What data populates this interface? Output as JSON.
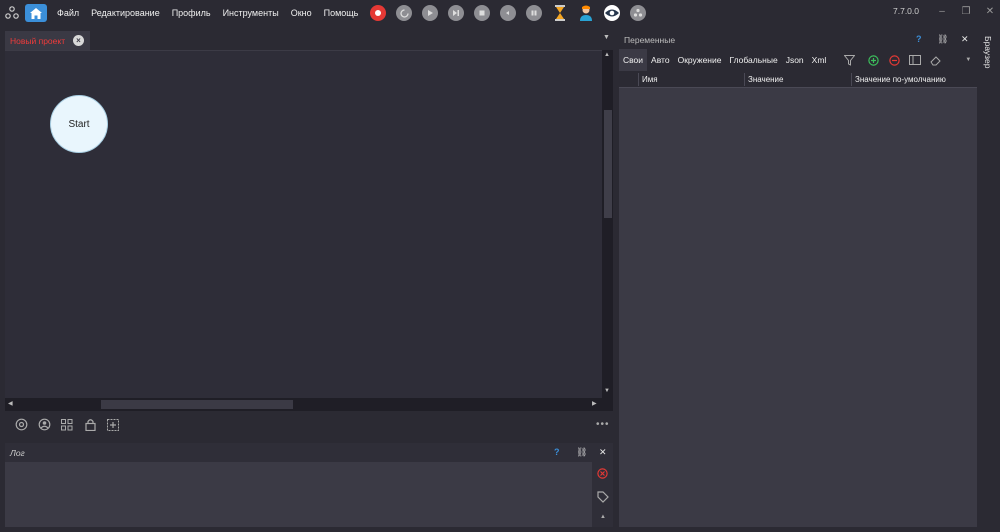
{
  "menu": [
    "Файл",
    "Редактирование",
    "Профиль",
    "Инструменты",
    "Окно",
    "Помощь"
  ],
  "toolbar_icons": [
    "record-icon",
    "restart-icon",
    "play-icon",
    "step-icon",
    "stop-icon",
    "undo-icon",
    "pause-icon",
    "hourglass-icon",
    "user-icon",
    "eye-icon",
    "network-icon"
  ],
  "version": "7.7.0.0",
  "editor": {
    "tab_title": "Новый проект",
    "start_node": "Start"
  },
  "log": {
    "title": "Лог",
    "help": "?"
  },
  "variables": {
    "title": "Переменные",
    "help": "?",
    "tabs": [
      "Свои",
      "Авто",
      "Окружение",
      "Глобальные",
      "Json",
      "Xml"
    ],
    "columns": [
      "Имя",
      "Значение",
      "Значение по-умолчанию"
    ]
  },
  "side_label": "Браузер",
  "colors": {
    "accent": "#3b8fd9",
    "tab_title": "#ee3b3b",
    "record": "#e53935"
  }
}
